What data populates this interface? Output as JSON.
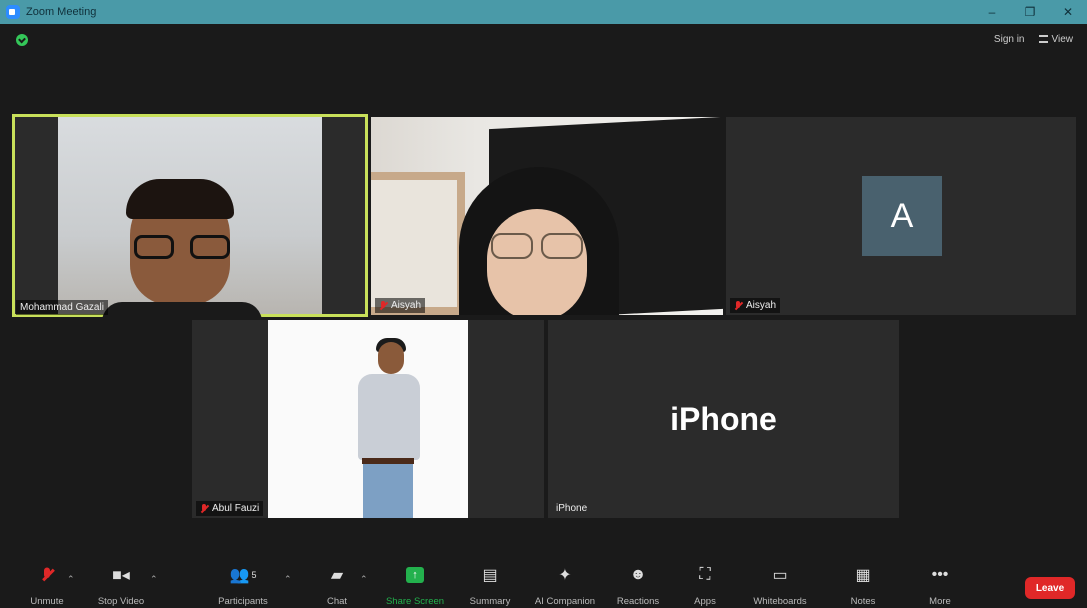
{
  "window": {
    "title": "Zoom Meeting",
    "minimize": "–",
    "restore": "❐",
    "close": "✕"
  },
  "header": {
    "sign_in": "Sign in",
    "view": "View"
  },
  "participants": [
    {
      "name": "Mohammad Gazali"
    },
    {
      "name": "Aisyah"
    },
    {
      "name": "Aisyah",
      "avatar_letter": "A"
    },
    {
      "name": "Abul Fauzi"
    },
    {
      "name": "iPhone",
      "display_name": "iPhone"
    }
  ],
  "toolbar": {
    "unmute": "Unmute",
    "stop_video": "Stop Video",
    "participants": "Participants",
    "participants_count": "5",
    "chat": "Chat",
    "share_screen": "Share Screen",
    "summary": "Summary",
    "ai_companion": "AI Companion",
    "reactions": "Reactions",
    "apps": "Apps",
    "whiteboards": "Whiteboards",
    "notes": "Notes",
    "more": "More",
    "leave": "Leave"
  },
  "colors": {
    "active_speaker": "#c8e05a",
    "leave": "#e02828",
    "share": "#23b14d",
    "titlebar": "#4a9aa8"
  }
}
